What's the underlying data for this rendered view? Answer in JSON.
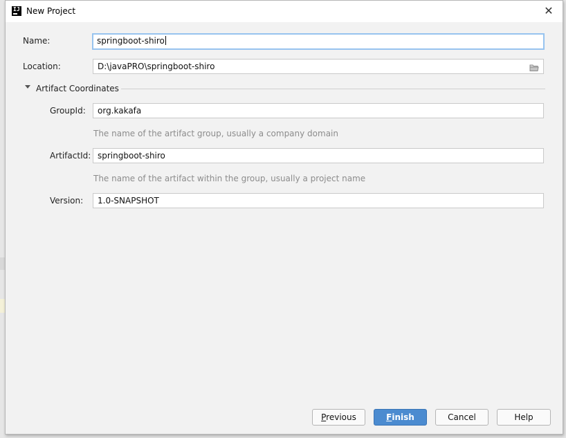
{
  "window": {
    "title": "New Project",
    "app_icon_text": "IJ"
  },
  "form": {
    "name_label": "Name:",
    "name_value": "springboot-shiro",
    "location_label": "Location:",
    "location_value": "D:\\javaPRO\\springboot-shiro"
  },
  "artifact": {
    "section_title": "Artifact Coordinates",
    "groupid_label": "GroupId:",
    "groupid_value": "org.kakafa",
    "groupid_hint": "The name of the artifact group, usually a company domain",
    "artifactid_label": "ArtifactId:",
    "artifactid_value": "springboot-shiro",
    "artifactid_hint": "The name of the artifact within the group, usually a project name",
    "version_label": "Version:",
    "version_value": "1.0-SNAPSHOT"
  },
  "buttons": {
    "previous": {
      "mnemonic": "P",
      "rest": "revious"
    },
    "finish": {
      "mnemonic": "F",
      "rest": "inish"
    },
    "cancel": "Cancel",
    "help": "Help"
  },
  "colors": {
    "accent": "#4b8bd0",
    "focus_ring": "#97c3ef",
    "hint_text": "#8c8c8c"
  },
  "icons": {
    "close": "close-icon",
    "folder": "folder-icon",
    "expand": "triangle-down-icon"
  }
}
